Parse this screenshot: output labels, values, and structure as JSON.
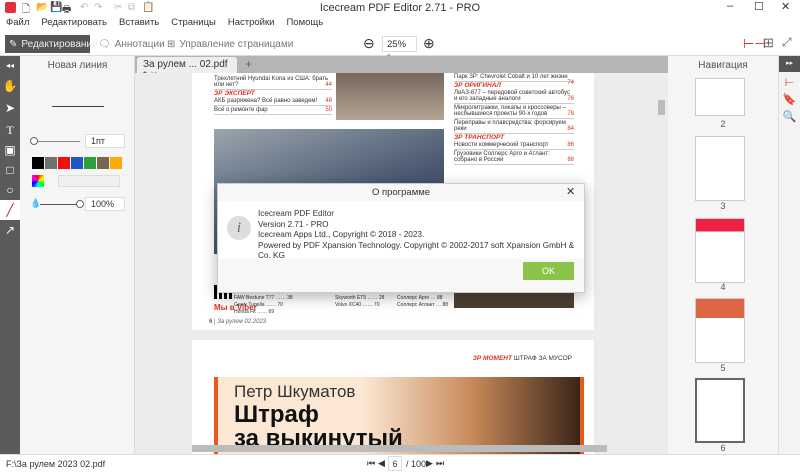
{
  "window": {
    "title": "Icecream PDF Editor 2.71 - PRO"
  },
  "menu": [
    "Файл",
    "Редактировать",
    "Вставить",
    "Страницы",
    "Настройки",
    "Помощь"
  ],
  "toolbar": {
    "edit": "Редактирование",
    "annot": "Аннотации",
    "pages": "Управление страницами",
    "zoom": "25%"
  },
  "tab": {
    "label": "За рулем ... 02.pdf *"
  },
  "left_panel": {
    "title": "Новая линия",
    "width": "1пт",
    "opacity": "100%",
    "colors": [
      "#000000",
      "#707070",
      "#ee1111",
      "#1f57c3",
      "#2f9e3f",
      "#7a6650",
      "#ffaa00"
    ]
  },
  "page": {
    "toc_left": [
      {
        "t": "Трехлетний Hyundai Kona из США: брать или нет?",
        "p": "44"
      }
    ],
    "sec_expert": "ЗР ЭКСПЕРТ",
    "toc_expert": [
      {
        "t": "АКБ разряжена? Всё равно заведем!",
        "p": "48"
      },
      {
        "t": "Всё о ремонте фар",
        "p": "50"
      }
    ],
    "toc_right": [
      {
        "t": "Парк ЗР: Chevrolet Cobalt и 10 лет жизни",
        "p": "74"
      }
    ],
    "sec_orig": "ЗР ОРИГИНАЛ",
    "toc_orig": [
      {
        "t": "ЛиАЗ-677 – передовой советский автобус и его западные аналоги",
        "p": "76"
      },
      {
        "t": "Микролитражки, пикапы и кроссоверы – несбывшиеся проекты 90-х годов",
        "p": "78"
      },
      {
        "t": "Переправы и плавсредства: форсируем реки",
        "p": "84"
      }
    ],
    "sec_trans": "ЗР ТРАНСПОРТ",
    "toc_trans": [
      {
        "t": "Новости коммерческий транспорт",
        "p": "86"
      },
      {
        "t": "Грузовики Соллерс Арго и Атлант: собрано в России",
        "p": "88"
      }
    ],
    "index": [
      [
        "FAW Bestune T77",
        "38"
      ],
      [
        "Geely Tugella",
        "70"
      ],
      [
        "Honda Fit",
        "69"
      ],
      [
        "Skyworth ET5",
        "28"
      ],
      [
        "Volvo XC40",
        "70"
      ],
      [
        "Соллерс Арго",
        "88"
      ],
      [
        "Соллерс Атлант",
        "88"
      ]
    ],
    "viber": "Мы в Viber",
    "footer_num": "6",
    "footer": "За рулем 02.2023",
    "p2_section": "ЗР МОМЕНТ",
    "p2_topic": "ШТРАФ ЗА МУСОР",
    "p2_author": "Петр Шкуматов",
    "p2_head1": "Штраф",
    "p2_head2": "за выкинутый"
  },
  "nav": {
    "title": "Навигация",
    "pages": [
      "2",
      "3",
      "4",
      "5",
      "6"
    ]
  },
  "dialog": {
    "title": "О программе",
    "lines": [
      "Icecream PDF Editor",
      "Version 2.71 - PRO",
      "Icecream Apps Ltd., Copyright © 2018 - 2023.",
      "Powered by PDF Xpansion Technology. Copyright © 2002-2017 soft Xpansion GmbH & Co. KG"
    ],
    "ok": "OK"
  },
  "status": {
    "path": "F:\\За рулем 2023 02.pdf",
    "page": "6",
    "total": "/ 100"
  }
}
